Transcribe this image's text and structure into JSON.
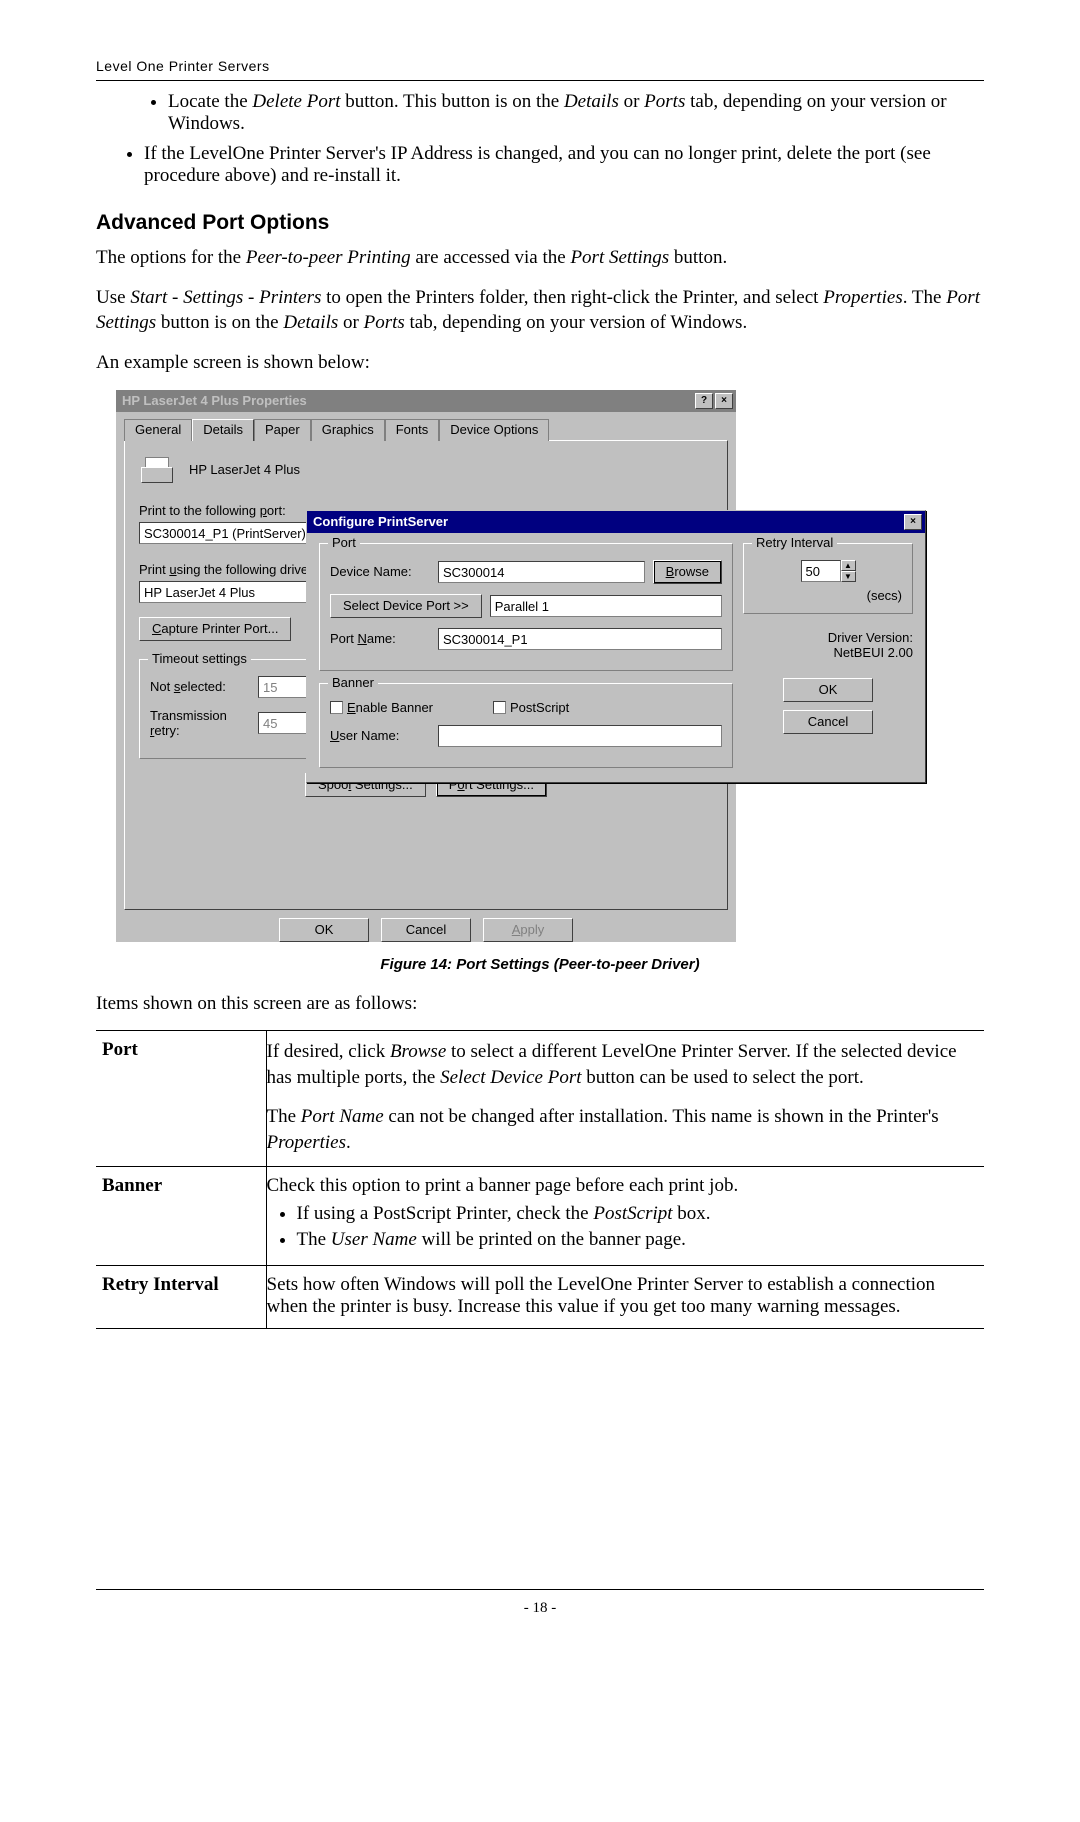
{
  "header": {
    "running_head": "Level One Printer Servers"
  },
  "content": {
    "nested_bullet": {
      "pre": "Locate the ",
      "i1": "Delete Port",
      "mid1": " button. This button is on the ",
      "i2": "Details",
      "mid2": " or ",
      "i3": "Ports",
      "post": " tab, depending on your version or Windows."
    },
    "top_bullet": "If the LevelOne Printer Server's IP Address is changed, and you can no longer print, delete the port (see procedure above) and re-install it.",
    "section_heading": "Advanced Port Options",
    "para1": {
      "pre": "The options for the ",
      "i1": "Peer-to-peer Printing",
      "mid": " are accessed via the ",
      "i2": "Port Settings",
      "post": " button."
    },
    "para2": {
      "pre": "Use ",
      "i1": "Start - Settings - Printers",
      "mid1": " to open the Printers folder, then right-click the Printer, and select ",
      "i2": "Properties",
      "mid2": ". The ",
      "i3": "Port Settings",
      "mid3": " button is on the ",
      "i4": "Details",
      "mid4": " or ",
      "i5": "Ports",
      "post": " tab, depending on your version of Windows."
    },
    "para3": "An example screen is shown below:"
  },
  "shot": {
    "main_window": {
      "title": "HP LaserJet 4 Plus Properties",
      "tabs": [
        "General",
        "Details",
        "Paper",
        "Graphics",
        "Fonts",
        "Device Options"
      ],
      "active_tab_index": 1,
      "printer_name": "HP LaserJet 4 Plus",
      "label_print_to_port": "Print to the following port:",
      "value_port": "SC300014_P1  (PrintServer)",
      "label_driver": "Print using the following driver:",
      "value_driver": "HP LaserJet 4 Plus",
      "btn_capture": "Capture Printer Port...",
      "group_timeout": "Timeout settings",
      "label_not_selected": "Not selected:",
      "val_not_selected": "15",
      "label_tx_retry": "Transmission retry:",
      "val_tx_retry": "45",
      "btn_spool": "Spool Settings...",
      "btn_port_settings": "Port Settings...",
      "btn_ok": "OK",
      "btn_cancel": "Cancel",
      "btn_apply": "Apply"
    },
    "dialog": {
      "title": "Configure PrintServer",
      "group_port": "Port",
      "label_device_name": "Device Name:",
      "val_device_name": "SC300014",
      "btn_browse": "Browse",
      "btn_select_port": "Select Device Port >>",
      "val_select_port": "Parallel 1",
      "label_port_name": "Port Name:",
      "val_port_name": "SC300014_P1",
      "group_banner": "Banner",
      "chk_enable_banner": "Enable Banner",
      "chk_postscript": "PostScript",
      "label_user_name": "User Name:",
      "group_retry": "Retry Interval",
      "val_retry": "50",
      "label_secs": "(secs)",
      "label_driver_version": "Driver Version:",
      "val_driver_version": "NetBEUI  2.00",
      "btn_ok": "OK",
      "btn_cancel": "Cancel"
    },
    "caption": "Figure 14: Port Settings (Peer-to-peer Driver)"
  },
  "after_shot_intro": "Items shown on this screen are as follows:",
  "table": {
    "row1": {
      "key": "Port",
      "p1": {
        "pre": "If desired, click ",
        "i1": "Browse",
        "mid1": " to select a different LevelOne Printer Server. If the selected device has multiple ports, the ",
        "i2": "Select Device Port",
        "post": " button can be used to select the port."
      },
      "p2": {
        "pre": "The ",
        "i1": "Port Name",
        "mid": " can not be changed after installation. This name is shown in the Printer's ",
        "i2": "Properties",
        "post": "."
      }
    },
    "row2": {
      "key": "Banner",
      "lead": "Check this option to print a banner page before each print job.",
      "li1": {
        "pre": "If using a PostScript Printer, check the ",
        "i1": "PostScript",
        "post": " box."
      },
      "li2": {
        "pre": "The ",
        "i1": "User Name",
        "post": " will be printed on the banner page."
      }
    },
    "row3": {
      "key": "Retry Interval",
      "text": "Sets how often Windows will poll the LevelOne Printer Server to establish a connection when the printer is busy. Increase this value if you get too many warning messages."
    }
  },
  "footer": {
    "page_number": "- 18 -"
  }
}
